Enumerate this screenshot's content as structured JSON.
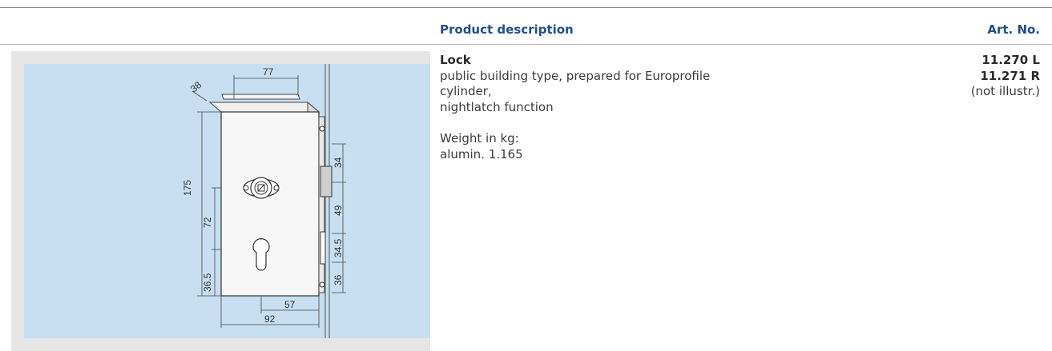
{
  "header": {
    "product_description": "Product description",
    "art_no": "Art. No."
  },
  "product": {
    "name": "Lock",
    "description_lines": [
      "public building type, prepared for Europrofile",
      "cylinder,",
      "nightlatch function"
    ],
    "weight_label": "Weight in kg:",
    "weight_value": "alumin. 1.165",
    "art_numbers": [
      "11.270 L",
      "11.271 R"
    ],
    "art_note": "(not illustr.)"
  },
  "drawing": {
    "dimensions": {
      "width_top": "77",
      "depth": "38",
      "height": "175",
      "mid": "72",
      "low": "36.5",
      "right_1": "34",
      "right_2": "49",
      "right_3": "34.5",
      "right_4": "36",
      "bottom_inner": "57",
      "bottom_total": "92"
    }
  }
}
